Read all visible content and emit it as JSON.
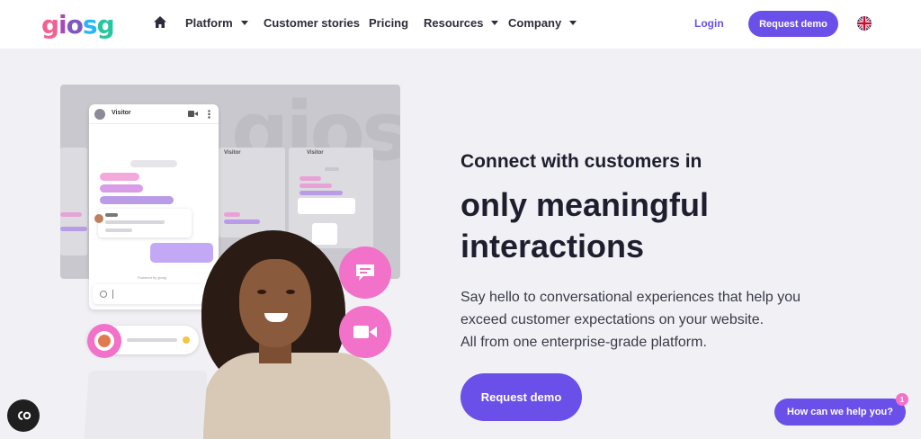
{
  "header": {
    "logo_letters": [
      "g",
      "i",
      "o",
      "s",
      "g"
    ],
    "nav": [
      {
        "label": "Platform",
        "dropdown": true
      },
      {
        "label": "Customer stories",
        "dropdown": false
      },
      {
        "label": "Pricing",
        "dropdown": false
      },
      {
        "label": "Resources",
        "dropdown": true
      },
      {
        "label": "Company",
        "dropdown": true
      }
    ],
    "login_label": "Login",
    "request_demo_label": "Request demo",
    "language_icon": "uk-flag-icon"
  },
  "hero": {
    "heading_small": "Connect with customers in",
    "heading_big_line1": "only meaningful",
    "heading_big_line2": "interactions",
    "paragraph_line1": "Say hello to conversational experiences that help you",
    "paragraph_line2": "exceed customer expectations on your website.",
    "paragraph_line3": "All from one enterprise-grade platform.",
    "cta_label": "Request demo"
  },
  "illustration": {
    "chat_title": "Visitor",
    "mini_chat_title_1": "Visitor",
    "mini_chat_title_2": "Visitor",
    "powered_by": "Powered by giosg",
    "watermark": "giosg"
  },
  "widgets": {
    "help_label": "How can we help you?",
    "help_badge": "1",
    "cookie_icon": "cookie-settings-icon"
  },
  "colors": {
    "accent": "#6a50e8",
    "pink": "#f271c9",
    "logo_g": "#f06292",
    "logo_i": "#ab47bc",
    "logo_o": "#7e57c2",
    "logo_s": "#29b6f6",
    "logo_g2": "#26c6a1"
  }
}
